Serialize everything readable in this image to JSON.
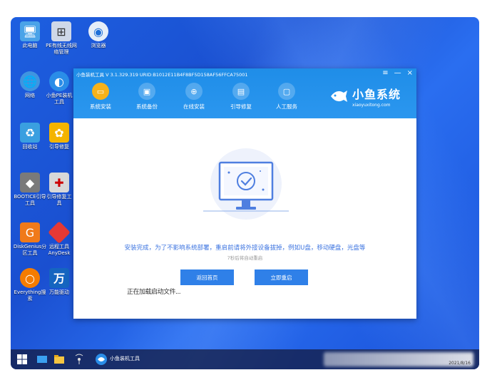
{
  "desktop": {
    "icons": [
      {
        "label": "此电脑",
        "icon": "computer-icon",
        "color": "#4aa3e8"
      },
      {
        "label": "PE有线无线网络管理",
        "icon": "network-manager-icon",
        "color": "#cfd8e8"
      },
      {
        "label": "浏览器",
        "icon": "browser-icon",
        "color": "#e6eef8"
      },
      {
        "label": "网络",
        "icon": "network-globe-icon",
        "color": "#3f95e0"
      },
      {
        "label": "小鱼PE装机工具",
        "icon": "xiaoyu-installer-icon",
        "color": "#2a8de8"
      },
      {
        "label": "回收站",
        "icon": "recycle-bin-icon",
        "color": "#3a9fe0"
      },
      {
        "label": "引导修复",
        "icon": "boot-repair-icon",
        "color": "#f4b400"
      },
      {
        "label": "BOOTICE引导工具",
        "icon": "bootice-icon",
        "color": "#7a7a7a"
      },
      {
        "label": "引导修复工具",
        "icon": "boot-repair-tool-icon",
        "color": "#d8d8d8"
      },
      {
        "label": "DiskGenius分区工具",
        "icon": "diskgenius-icon",
        "color": "#f07a1a"
      },
      {
        "label": "远程工具AnyDesk",
        "icon": "anydesk-icon",
        "color": "#e53935"
      },
      {
        "label": "Everything搜索",
        "icon": "everything-search-icon",
        "color": "#f57c00"
      },
      {
        "label": "万能驱动",
        "icon": "universal-driver-icon",
        "color": "#1565c0"
      }
    ]
  },
  "window": {
    "title": "小鱼装机工具 V 3.1.329.319 URID:B1012E11B4F8BF5D158AF56FFCA75001",
    "controls": {
      "menu": "≡",
      "minimize": "—",
      "close": "×"
    },
    "nav": [
      {
        "label": "系统安装",
        "active": true
      },
      {
        "label": "系统备份",
        "active": false
      },
      {
        "label": "在线安装",
        "active": false
      },
      {
        "label": "引导修复",
        "active": false
      },
      {
        "label": "人工服务",
        "active": false
      }
    ],
    "brand": {
      "name": "小鱼系统",
      "url": "xiaoyuxitong.com"
    },
    "accent": "#2b97ef",
    "message": "安装完成，为了不影响系统部署，重启前请将外接设备拔掉，例如U盘，移动硬盘，光盘等",
    "countdown": "7秒后将自动重启",
    "buttons": {
      "back": "返回首页",
      "restart": "立即重启"
    },
    "status": "正在加载启动文件..."
  },
  "taskbar": {
    "app_label": "小鱼装机工具",
    "date": "2021/8/16"
  }
}
